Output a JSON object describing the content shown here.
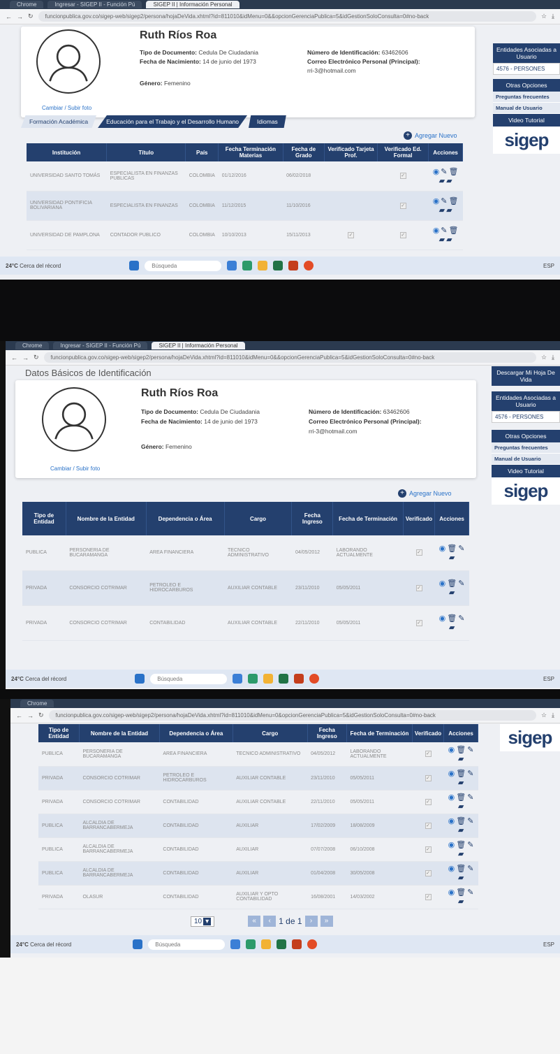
{
  "browser": {
    "tab1": "Chrome",
    "tab2": "Ingresar - SIGEP II - Función Pú",
    "tab3": "SIGEP II | Información Personal",
    "url": "funcionpublica.gov.co/sigep-web/sigep2/persona/hojaDeVida.xhtml?id=811010&idMenu=0&&opcionGerenciaPublica=5&idGestionSoloConsulta=0#no-back",
    "url_short": "funcionpublica.gov.co/sigep-web/sigep2/persona/hojaDeVida.xhtml?id=811010&idMenu=0&opcionGerenciaPublica=5&idGestionSoloConsulta=0#no-back"
  },
  "profile": {
    "section_title": "Datos Básicos de Identificación",
    "name": "Ruth Ríos Roa",
    "doc_type_label": "Tipo de Documento:",
    "doc_type_value": "Cedula De Ciudadania",
    "birth_label": "Fecha de Nacimiento:",
    "birth_value": "14 de junio del 1973",
    "id_label": "Número de Identificación:",
    "id_value": "63462606",
    "email_label": "Correo Electrónico Personal (Principal):",
    "email_value": "rri-3@hotmail.com",
    "gender_label": "Género:",
    "gender_value": "Femenino",
    "photo_link": "Cambiar / Subir foto"
  },
  "sidebar": {
    "download": "Descargar Mi Hoja De Vida",
    "entities_title": "Entidades Asociadas a Usuario",
    "entities_value": "4576 - PERSONES",
    "other_options": "Otras Opciones",
    "faq": "Preguntas frecuentes",
    "manual": "Manual de Usuario",
    "video": "Video Tutorial",
    "logo_text": "sigep"
  },
  "edu_tabs": [
    "Formación Académica",
    "Educación para el Trabajo y el Desarrollo Humano",
    "Idiomas"
  ],
  "add_new": "Agregar Nuevo",
  "edu_table": {
    "headers": [
      "Institución",
      "Título",
      "País",
      "Fecha Terminación Materias",
      "Fecha de Grado",
      "Verificado Tarjeta Prof.",
      "Verificado Ed. Formal",
      "Acciones"
    ],
    "rows": [
      [
        "Universidad Santo Tomás",
        "Especialista en Finanzas Publicas",
        "Colombia",
        "01/12/2016",
        "06/02/2018"
      ],
      [
        "Universidad Pontificia Bolivariana",
        "Especialista en Finanzas",
        "Colombia",
        "11/12/2015",
        "11/10/2016"
      ],
      [
        "Universidad de Pamplona",
        "Contador Publico",
        "Colombia",
        "10/10/2013",
        "15/11/2013"
      ]
    ]
  },
  "exp_table": {
    "headers": [
      "Tipo de Entidad",
      "Nombre de la Entidad",
      "Dependencia o Área",
      "Cargo",
      "Fecha Ingreso",
      "Fecha de Terminación",
      "Verificado",
      "Acciones"
    ],
    "rows": [
      [
        "Publica",
        "Personeria de Bucaramanga",
        "Area Financiera",
        "Tecnico Administrativo",
        "04/05/2012",
        "Laborando Actualmente"
      ],
      [
        "Privada",
        "Consorcio Cotrimar",
        "Petroleo e Hidrocarburos",
        "Auxiliar Contable",
        "23/11/2010",
        "05/05/2011"
      ],
      [
        "Privada",
        "Consorcio Cotrimar",
        "Contabilidad",
        "Auxiliar Contable",
        "22/11/2010",
        "05/05/2011"
      ],
      [
        "Publica",
        "Alcaldia de Barrancabermeja",
        "Contabilidad",
        "Auxiliar",
        "17/02/2009",
        "18/08/2009"
      ],
      [
        "Publica",
        "Alcaldia de Barrancabermeja",
        "Contabilidad",
        "Auxiliar",
        "07/07/2008",
        "06/10/2008"
      ],
      [
        "Publica",
        "Alcaldia de Barrancabermeja",
        "Contabilidad",
        "Auxiliar",
        "01/04/2008",
        "30/05/2008"
      ],
      [
        "Privada",
        "Olasur",
        "Contabilidad",
        "Auxiliar y Opto Contabilidad",
        "16/08/2001",
        "14/03/2002"
      ]
    ]
  },
  "pager": {
    "per_page": "10",
    "page_text": "1 de 1"
  },
  "taskbar": {
    "weather": "24°C",
    "weather_sub": "Cerca del récord",
    "search": "Búsqueda",
    "lang": "ESP"
  }
}
